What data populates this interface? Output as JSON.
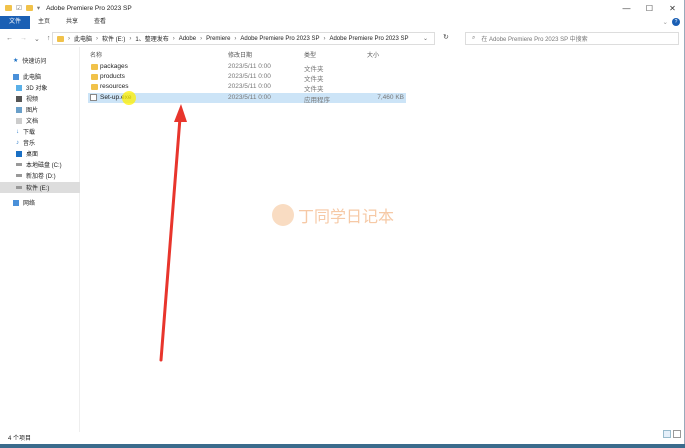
{
  "window": {
    "title": "Adobe Premiere Pro 2023 SP",
    "controls": [
      "—",
      "☐",
      "✕"
    ]
  },
  "ribbon": {
    "tabs": [
      "文件",
      "主页",
      "共享",
      "查看"
    ]
  },
  "address": {
    "path": [
      "此电脑",
      "软件 (E:)",
      "1、整理发布",
      "Adobe",
      "Premiere",
      "Adobe Premiere Pro 2023 SP",
      "Adobe Premiere Pro 2023 SP"
    ],
    "search_placeholder": "在 Adobe Premiere Pro 2023 SP 中搜索"
  },
  "sidebar": {
    "items": [
      {
        "label": "快速访问",
        "icon": "star-icon"
      },
      {
        "label": "此电脑",
        "icon": "computer-icon"
      },
      {
        "label": "3D 对象",
        "icon": "cube-icon"
      },
      {
        "label": "视频",
        "icon": "video-icon"
      },
      {
        "label": "图片",
        "icon": "picture-icon"
      },
      {
        "label": "文档",
        "icon": "document-icon"
      },
      {
        "label": "下载",
        "icon": "download-icon"
      },
      {
        "label": "音乐",
        "icon": "music-icon"
      },
      {
        "label": "桌面",
        "icon": "desktop-icon"
      },
      {
        "label": "本地磁盘 (C:)",
        "icon": "drive-icon"
      },
      {
        "label": "新加卷 (D:)",
        "icon": "drive-icon"
      },
      {
        "label": "软件 (E:)",
        "icon": "drive-icon"
      },
      {
        "label": "网络",
        "icon": "network-icon"
      }
    ]
  },
  "columns": {
    "name": "名称",
    "date": "修改日期",
    "type": "类型",
    "size": "大小"
  },
  "files": [
    {
      "name": "packages",
      "date": "2023/5/11 0:00",
      "type": "文件夹",
      "size": ""
    },
    {
      "name": "products",
      "date": "2023/5/11 0:00",
      "type": "文件夹",
      "size": ""
    },
    {
      "name": "resources",
      "date": "2023/5/11 0:00",
      "type": "文件夹",
      "size": ""
    },
    {
      "name": "Set-up.exe",
      "date": "2023/5/11 0:00",
      "type": "应用程序",
      "size": "7,460 KB"
    }
  ],
  "status": {
    "count": "4 个项目"
  },
  "watermark": "丁同学日记本",
  "colors": {
    "accent": "#1a5fb4",
    "selection": "#cce4f7",
    "arrow": "#e8352c"
  }
}
